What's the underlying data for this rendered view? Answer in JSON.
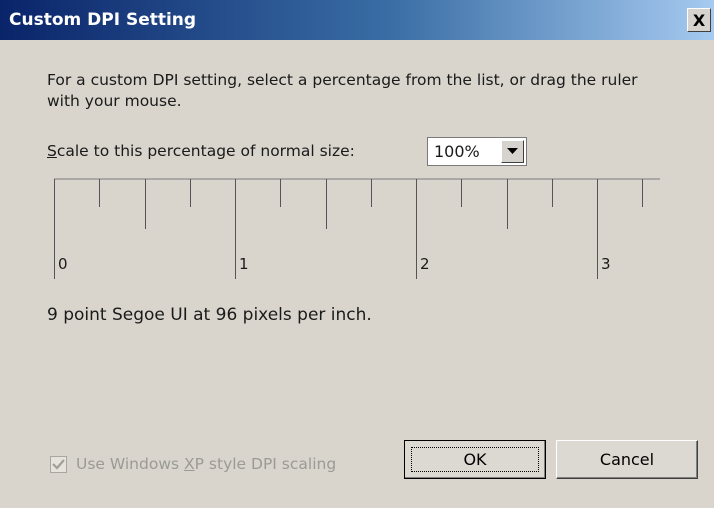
{
  "window": {
    "title": "Custom DPI Setting",
    "close_glyph": "X"
  },
  "description": "For a custom DPI setting, select a percentage from the list, or drag the ruler with your mouse.",
  "scale": {
    "label_prefix": "",
    "label_mnemonic": "S",
    "label_rest": "cale to this percentage of normal size:",
    "selected": "100%"
  },
  "ruler": {
    "labels": [
      "0",
      "1",
      "2",
      "3"
    ]
  },
  "info_text": "9 point Segoe UI at 96 pixels per inch.",
  "xp_scaling": {
    "label_before": "Use Windows ",
    "label_mnemonic": "X",
    "label_after": "P style DPI scaling",
    "checked": true,
    "enabled": false
  },
  "buttons": {
    "ok": "OK",
    "cancel": "Cancel"
  }
}
